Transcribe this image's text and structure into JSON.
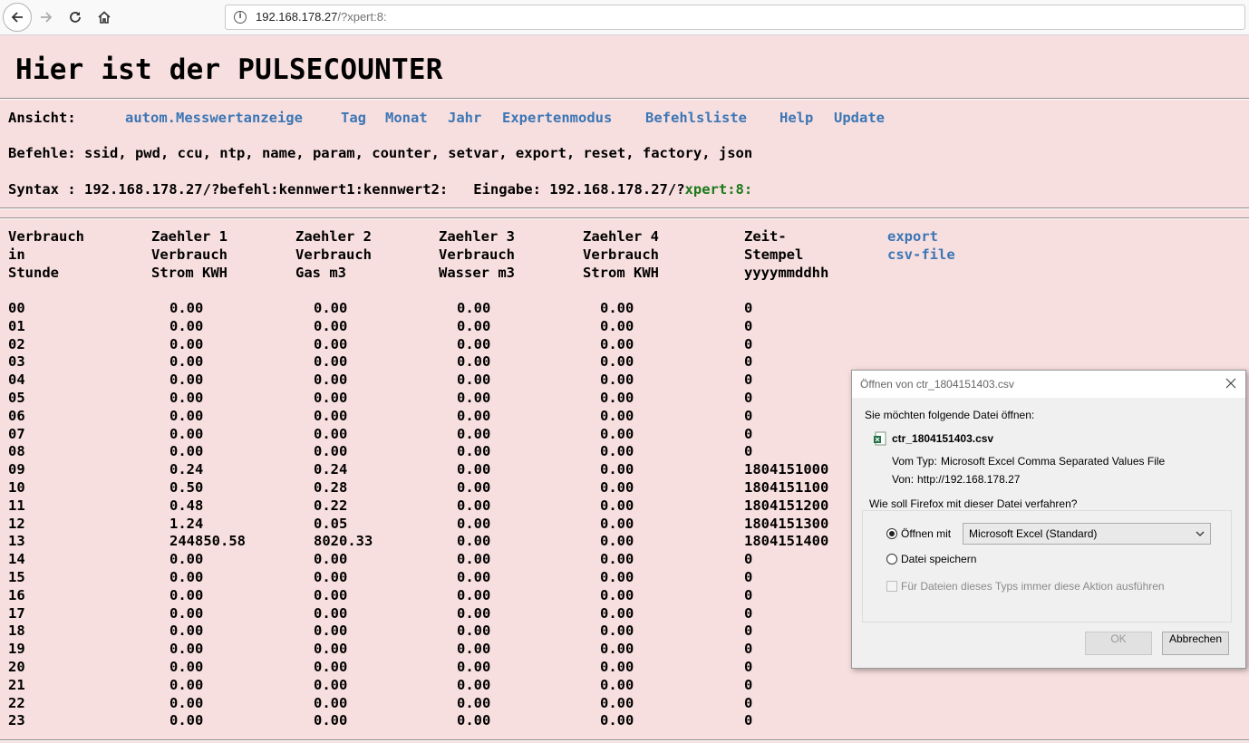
{
  "browser": {
    "url_host": "192.168.178.27",
    "url_rest": "/?xpert:8:"
  },
  "page": {
    "title": "Hier ist der PULSECOUNTER",
    "ansicht_label": "Ansicht:",
    "nav_links": [
      "autom.Messwertanzeige",
      "Tag",
      "Monat",
      "Jahr",
      "Expertenmodus",
      "Befehlsliste",
      "Help",
      "Update"
    ],
    "befehle_line": "Befehle: ssid, pwd, ccu, ntp, name, param, counter, setvar, export, reset, factory, json",
    "syntax_line": "Syntax : 192.168.178.27/?befehl:kennwert1:kennwert2:   Eingabe: 192.168.178.27/?",
    "syntax_input": "xpert:8:"
  },
  "table": {
    "headers": [
      [
        "Verbrauch",
        "in",
        "Stunde"
      ],
      [
        "Zaehler 1",
        "Verbrauch",
        "Strom KWH"
      ],
      [
        "Zaehler 2",
        "Verbrauch",
        "Gas m3"
      ],
      [
        "Zaehler 3",
        "Verbrauch",
        "Wasser m3"
      ],
      [
        "Zaehler 4",
        "Verbrauch",
        "Strom KWH"
      ],
      [
        "Zeit-",
        "Stempel",
        "yyyymmddhh"
      ]
    ],
    "export_link": [
      "export",
      "csv-file"
    ],
    "rows": [
      [
        "00",
        "0.00",
        "0.00",
        "0.00",
        "0.00",
        "0"
      ],
      [
        "01",
        "0.00",
        "0.00",
        "0.00",
        "0.00",
        "0"
      ],
      [
        "02",
        "0.00",
        "0.00",
        "0.00",
        "0.00",
        "0"
      ],
      [
        "03",
        "0.00",
        "0.00",
        "0.00",
        "0.00",
        "0"
      ],
      [
        "04",
        "0.00",
        "0.00",
        "0.00",
        "0.00",
        "0"
      ],
      [
        "05",
        "0.00",
        "0.00",
        "0.00",
        "0.00",
        "0"
      ],
      [
        "06",
        "0.00",
        "0.00",
        "0.00",
        "0.00",
        "0"
      ],
      [
        "07",
        "0.00",
        "0.00",
        "0.00",
        "0.00",
        "0"
      ],
      [
        "08",
        "0.00",
        "0.00",
        "0.00",
        "0.00",
        "0"
      ],
      [
        "09",
        "0.24",
        "0.24",
        "0.00",
        "0.00",
        "1804151000"
      ],
      [
        "10",
        "0.50",
        "0.28",
        "0.00",
        "0.00",
        "1804151100"
      ],
      [
        "11",
        "0.48",
        "0.22",
        "0.00",
        "0.00",
        "1804151200"
      ],
      [
        "12",
        "1.24",
        "0.05",
        "0.00",
        "0.00",
        "1804151300"
      ],
      [
        "13",
        "244850.58",
        "8020.33",
        "0.00",
        "0.00",
        "1804151400"
      ],
      [
        "14",
        "0.00",
        "0.00",
        "0.00",
        "0.00",
        "0"
      ],
      [
        "15",
        "0.00",
        "0.00",
        "0.00",
        "0.00",
        "0"
      ],
      [
        "16",
        "0.00",
        "0.00",
        "0.00",
        "0.00",
        "0"
      ],
      [
        "17",
        "0.00",
        "0.00",
        "0.00",
        "0.00",
        "0"
      ],
      [
        "18",
        "0.00",
        "0.00",
        "0.00",
        "0.00",
        "0"
      ],
      [
        "19",
        "0.00",
        "0.00",
        "0.00",
        "0.00",
        "0"
      ],
      [
        "20",
        "0.00",
        "0.00",
        "0.00",
        "0.00",
        "0"
      ],
      [
        "21",
        "0.00",
        "0.00",
        "0.00",
        "0.00",
        "0"
      ],
      [
        "22",
        "0.00",
        "0.00",
        "0.00",
        "0.00",
        "0"
      ],
      [
        "23",
        "0.00",
        "0.00",
        "0.00",
        "0.00",
        "0"
      ]
    ]
  },
  "dialog": {
    "title": "Öffnen von ctr_1804151403.csv",
    "prompt": "Sie möchten folgende Datei öffnen:",
    "filename": "ctr_1804151403.csv",
    "type_label": "Vom Typ:",
    "type_value": "Microsoft Excel Comma Separated Values File",
    "from_label": "Von:",
    "from_value": "http://192.168.178.27",
    "group_label": "Wie soll Firefox mit dieser Datei verfahren?",
    "open_with_label": "Öffnen mit",
    "open_with_app": "Microsoft Excel (Standard)",
    "save_label": "Datei speichern",
    "always_label": "Für Dateien dieses Typs immer diese Aktion ausführen",
    "ok_label": "OK",
    "cancel_label": "Abbrechen",
    "selected_option": "open_with"
  },
  "colors": {
    "page_bg": "#f8dfdf",
    "link": "#3b76b5",
    "input_green": "#1a7a1a"
  }
}
